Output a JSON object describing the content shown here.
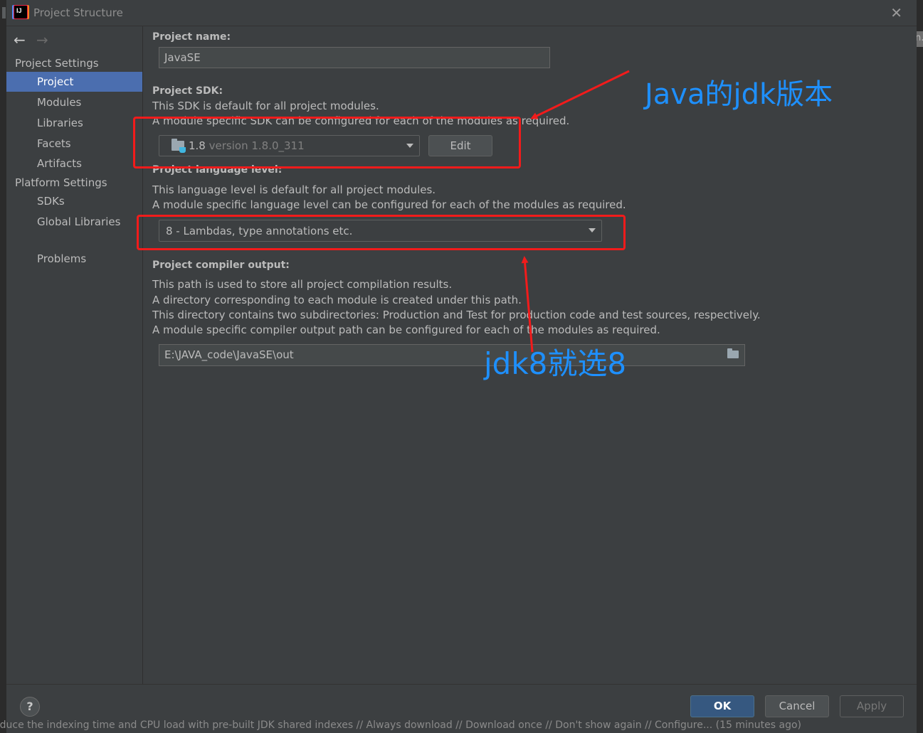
{
  "window": {
    "title": "Project Structure",
    "app_icon": "intellij-idea-icon",
    "close_icon": "close-icon"
  },
  "edge": {
    "right_fragment": "n."
  },
  "sidebar": {
    "back_icon": "arrow-left-icon",
    "forward_icon": "arrow-right-icon",
    "group_project": "Project Settings",
    "group_platform": "Platform Settings",
    "items": [
      {
        "label": "Project",
        "selected": true
      },
      {
        "label": "Modules"
      },
      {
        "label": "Libraries"
      },
      {
        "label": "Facets"
      },
      {
        "label": "Artifacts"
      },
      {
        "label": "SDKs"
      },
      {
        "label": "Global Libraries"
      },
      {
        "label": "Problems"
      }
    ]
  },
  "project": {
    "name_label": "Project name:",
    "name_value": "JavaSE",
    "sdk_label": "Project SDK:",
    "sdk_desc1": "This SDK is default for all project modules.",
    "sdk_desc2": "A module specific SDK can be configured for each of the modules as required.",
    "sdk_value_main": "1.8",
    "sdk_value_detail": "version 1.8.0_311",
    "edit_label": "Edit",
    "lang_label": "Project language level:",
    "lang_desc1": "This language level is default for all project modules.",
    "lang_desc2": "A module specific language level can be configured for each of the modules as required.",
    "lang_value": "8 - Lambdas, type annotations etc.",
    "output_label": "Project compiler output:",
    "output_desc1": "This path is used to store all project compilation results.",
    "output_desc2": "A directory corresponding to each module is created under this path.",
    "output_desc3": "This directory contains two subdirectories: Production and Test for production code and test sources, respectively.",
    "output_desc4": "A module specific compiler output path can be configured for each of the modules as required.",
    "output_value": "E:\\JAVA_code\\JavaSE\\out"
  },
  "buttons": {
    "help": "?",
    "ok": "OK",
    "cancel": "Cancel",
    "apply": "Apply"
  },
  "status_bar": "educe the indexing time and CPU load with pre-built JDK shared indexes // Always download // Download once // Don't show again // Configure... (15 minutes ago)",
  "annotations": {
    "sdk_note": "Java的jdk版本",
    "lang_note": "jdk8就选8",
    "color": "#1e90ff",
    "box_color": "#f21b1b"
  }
}
